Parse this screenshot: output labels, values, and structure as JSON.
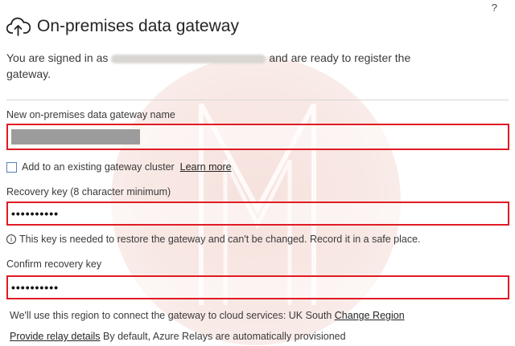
{
  "help_label": "?",
  "header": {
    "title": "On-premises data gateway",
    "icon": "cloud-upload-icon"
  },
  "subtitle": {
    "before": "You are signed in as",
    "after": "and are ready to register the gateway."
  },
  "gateway_name": {
    "label": "New on-premises data gateway name"
  },
  "cluster": {
    "checkbox_label": "Add to an existing gateway cluster",
    "checked": false,
    "learn_more": "Learn more"
  },
  "recovery_key": {
    "label": "Recovery key (8 character minimum)",
    "value": "••••••••••",
    "note": "This key is needed to restore the gateway and can't be changed. Record it in a safe place."
  },
  "confirm_key": {
    "label": "Confirm recovery key",
    "value": "••••••••••"
  },
  "region": {
    "text": "We'll use this region to connect the gateway to cloud services: UK South",
    "change_link": "Change Region"
  },
  "relay": {
    "link": "Provide relay details",
    "text": "By default, Azure Relays are automatically provisioned"
  },
  "colors": {
    "highlight_border": "#e01b24",
    "watermark": "#f3d8d2"
  }
}
